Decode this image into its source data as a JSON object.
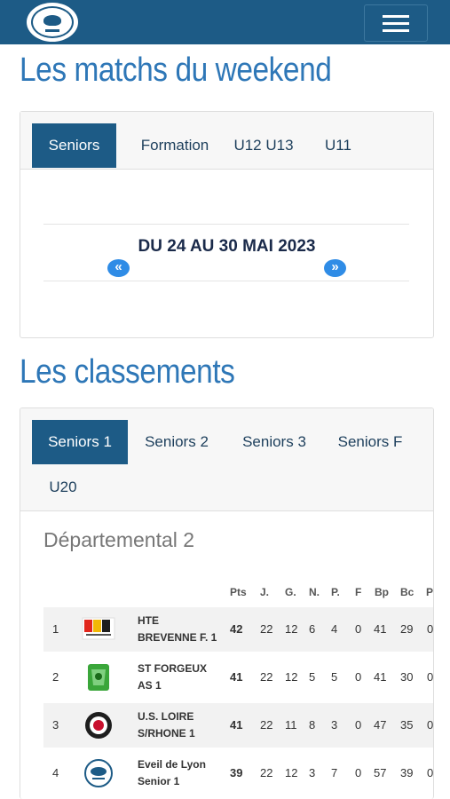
{
  "header": {
    "logo_icon": "club-crest-icon",
    "menu_icon": "hamburger-menu-icon"
  },
  "matches": {
    "title": "Les matchs du weekend",
    "tabs": [
      "Seniors",
      "Formation",
      "U12 U13",
      "U11"
    ],
    "active_tab": "Seniors",
    "date_range": "DU 24 AU 30 MAI 2023",
    "prev_icon": "double-chevron-left-icon",
    "next_icon": "double-chevron-right-icon"
  },
  "rankings": {
    "title": "Les classements",
    "tabs": [
      "Seniors 1",
      "Seniors 2",
      "Seniors 3",
      "Seniors F",
      "U20"
    ],
    "active_tab": "Seniors 1",
    "division": "Départemental 2",
    "columns": [
      "Pts",
      "J.",
      "G.",
      "N.",
      "P.",
      "F",
      "Bp",
      "Bc",
      "Pé"
    ],
    "rows": [
      {
        "rank": "1",
        "team_line1": "HTE",
        "team_line2": "BREVENNE F. 1",
        "pts": "42",
        "j": "22",
        "g": "12",
        "n": "6",
        "p": "4",
        "f": "0",
        "bp": "41",
        "bc": "29",
        "pe": "0"
      },
      {
        "rank": "2",
        "team_line1": "ST FORGEUX",
        "team_line2": "AS 1",
        "pts": "41",
        "j": "22",
        "g": "12",
        "n": "5",
        "p": "5",
        "f": "0",
        "bp": "41",
        "bc": "30",
        "pe": "0"
      },
      {
        "rank": "3",
        "team_line1": "U.S. LOIRE",
        "team_line2": "S/RHONE 1",
        "pts": "41",
        "j": "22",
        "g": "11",
        "n": "8",
        "p": "3",
        "f": "0",
        "bp": "47",
        "bc": "35",
        "pe": "0"
      },
      {
        "rank": "4",
        "team_line1": "Eveil de Lyon",
        "team_line2": "Senior 1",
        "pts": "39",
        "j": "22",
        "g": "12",
        "n": "3",
        "p": "7",
        "f": "0",
        "bp": "57",
        "bc": "39",
        "pe": "0"
      }
    ]
  },
  "colors": {
    "header_bg": "#1d5b86",
    "title": "#2e77b7",
    "active_tab": "#1d5b86",
    "arrow": "#2f8ce6"
  }
}
